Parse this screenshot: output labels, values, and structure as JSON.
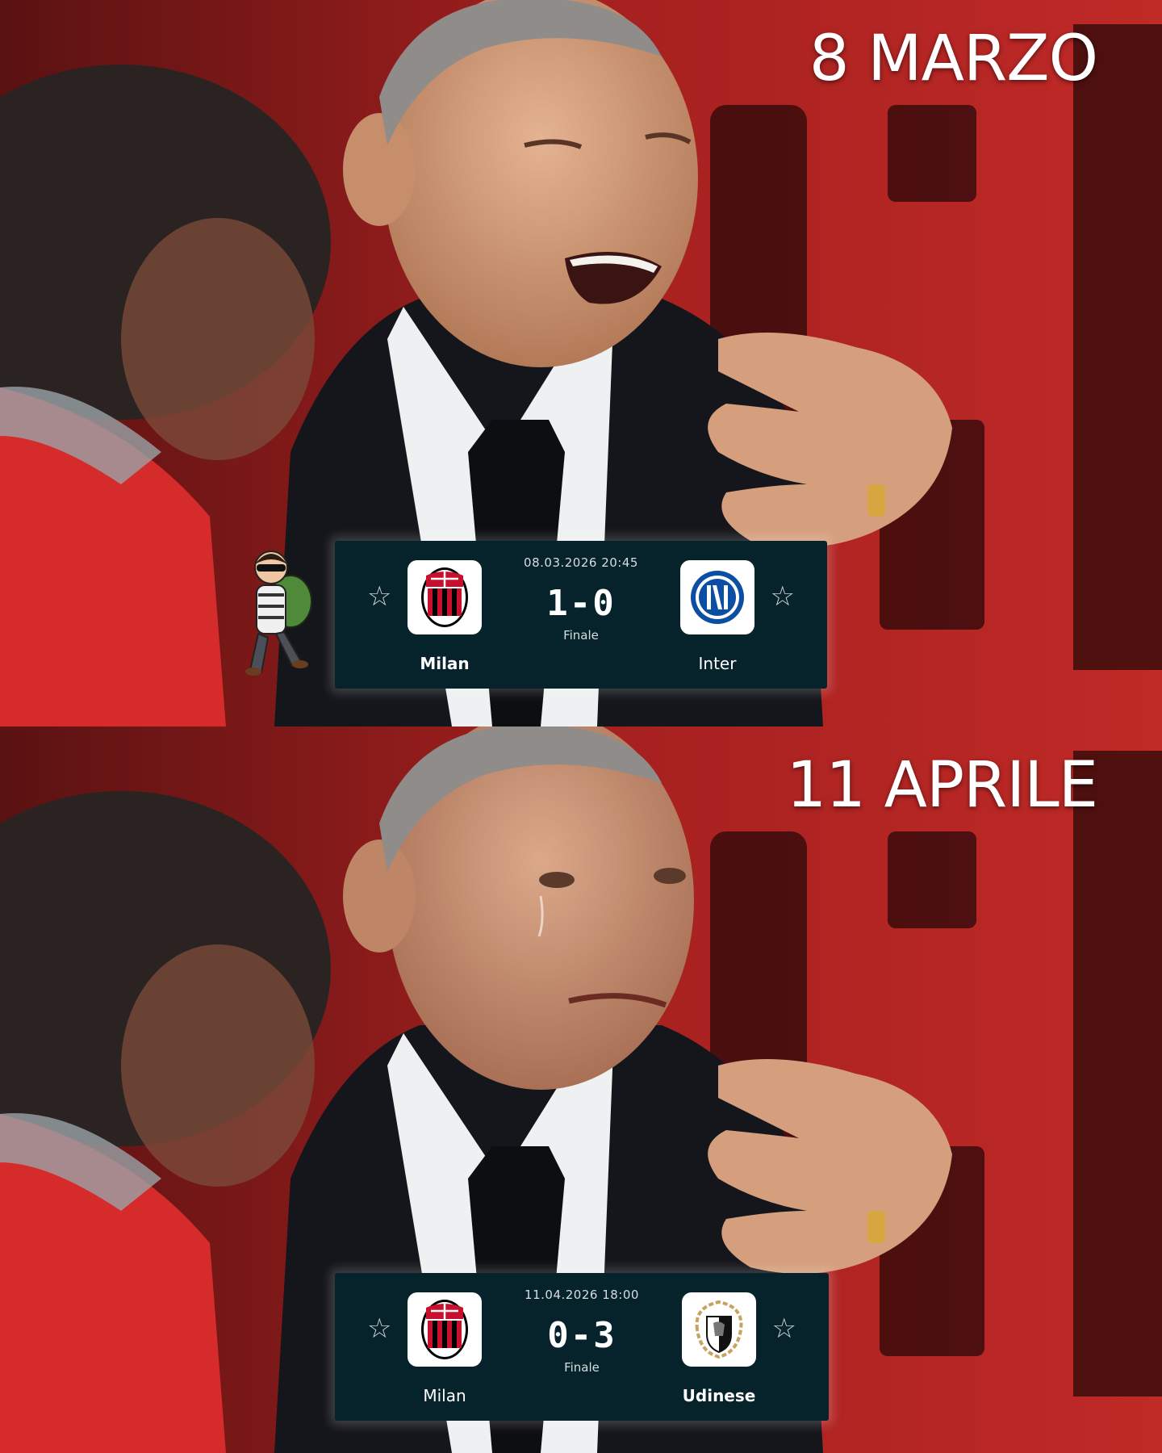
{
  "panels": [
    {
      "caption": "8 MARZO",
      "match": {
        "datetime": "08.03.2026 20:45",
        "score": "1-0",
        "status": "Finale",
        "home_team": "Milan",
        "away_team": "Inter"
      }
    },
    {
      "caption": "11 APRILE",
      "match": {
        "datetime": "11.04.2026 18:00",
        "score": "0-3",
        "status": "Finale",
        "home_team": "Milan",
        "away_team": "Udinese"
      }
    }
  ],
  "icons": {
    "star": "☆",
    "milan_logo": "ac-milan-crest-icon",
    "inter_logo": "inter-crest-icon",
    "udinese_logo": "udinese-crest-icon",
    "sticker": "thief-cartoon-icon"
  },
  "colors": {
    "card_bg": "#06222b",
    "caption": "#ffffff",
    "milan_red": "#c8102e",
    "inter_blue": "#0a4fa3"
  },
  "milan_crest_text": "ACM 1899"
}
